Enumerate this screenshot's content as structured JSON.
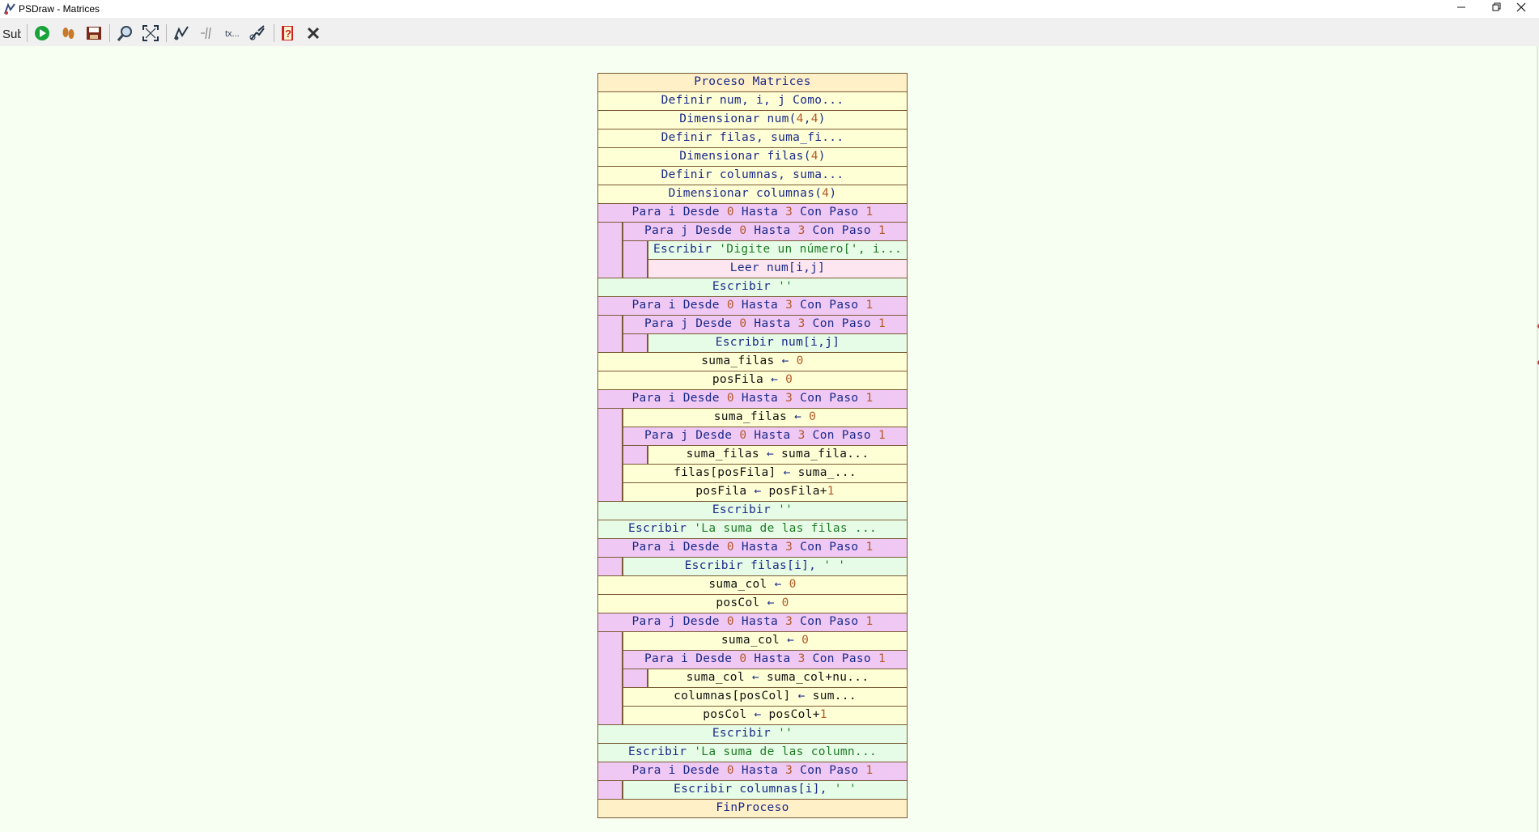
{
  "window": {
    "title": "PSDraw - Matrices",
    "controls": [
      "minimize",
      "restore",
      "close"
    ]
  },
  "toolbar": {
    "buttons": [
      {
        "name": "sub",
        "label": "Sub",
        "icon": "sub-icon"
      },
      {
        "name": "run",
        "icon": "play-icon"
      },
      {
        "name": "step",
        "icon": "footsteps-icon"
      },
      {
        "name": "save",
        "icon": "save-icon"
      },
      {
        "name": "zoom",
        "icon": "magnifier-icon"
      },
      {
        "name": "fit",
        "icon": "fit-screen-icon"
      },
      {
        "name": "edit-flow",
        "icon": "flow-edit-icon"
      },
      {
        "name": "comment",
        "icon": "comment-icon"
      },
      {
        "name": "text",
        "icon": "text-icon"
      },
      {
        "name": "tools",
        "icon": "tools-icon"
      },
      {
        "name": "help",
        "icon": "help-icon"
      },
      {
        "name": "close",
        "icon": "close-x-icon"
      }
    ]
  },
  "colors": {
    "background": "#f6fff1",
    "process": "#fff0c8",
    "assign": "#ffffd6",
    "loop": "#f0c8f4",
    "write": "#e6fce6",
    "read": "#fde6ef",
    "keyword": "#1a2a8a",
    "number": "#b35a2a",
    "string": "#207a28"
  },
  "diagram": {
    "blocks": [
      {
        "type": "proc",
        "depth": 0,
        "parts": [
          [
            "k",
            "Proceso Matrices"
          ]
        ]
      },
      {
        "type": "def",
        "depth": 0,
        "parts": [
          [
            "k",
            "Definir num, i, j Como..."
          ]
        ]
      },
      {
        "type": "def",
        "depth": 0,
        "parts": [
          [
            "k",
            "Dimensionar "
          ],
          [
            "t",
            "num("
          ],
          [
            "n",
            "4"
          ],
          [
            "t",
            ","
          ],
          [
            "n",
            "4"
          ],
          [
            "t",
            ")"
          ]
        ]
      },
      {
        "type": "def",
        "depth": 0,
        "parts": [
          [
            "k",
            "Definir filas, suma_fi..."
          ]
        ]
      },
      {
        "type": "def",
        "depth": 0,
        "parts": [
          [
            "k",
            "Dimensionar "
          ],
          [
            "t",
            "filas("
          ],
          [
            "n",
            "4"
          ],
          [
            "t",
            ")"
          ]
        ]
      },
      {
        "type": "def",
        "depth": 0,
        "parts": [
          [
            "k",
            "Definir columnas, suma..."
          ]
        ]
      },
      {
        "type": "def",
        "depth": 0,
        "parts": [
          [
            "k",
            "Dimensionar "
          ],
          [
            "t",
            "columnas("
          ],
          [
            "n",
            "4"
          ],
          [
            "t",
            ")"
          ]
        ]
      },
      {
        "type": "for",
        "depth": 0,
        "parts": [
          [
            "k",
            "Para i Desde "
          ],
          [
            "n",
            "0"
          ],
          [
            "k",
            " Hasta "
          ],
          [
            "n",
            "3"
          ],
          [
            "k",
            " Con Paso "
          ],
          [
            "n",
            "1"
          ]
        ]
      },
      {
        "type": "for",
        "depth": 1,
        "parts": [
          [
            "k",
            "Para j Desde "
          ],
          [
            "n",
            "0"
          ],
          [
            "k",
            " Hasta "
          ],
          [
            "n",
            "3"
          ],
          [
            "k",
            " Con Paso "
          ],
          [
            "n",
            "1"
          ]
        ]
      },
      {
        "type": "write",
        "depth": 2,
        "parts": [
          [
            "k",
            "Escribir "
          ],
          [
            "s",
            "'Digite un número[', i..."
          ]
        ]
      },
      {
        "type": "read",
        "depth": 2,
        "parts": [
          [
            "k",
            "Leer "
          ],
          [
            "t",
            "num[i,j]"
          ]
        ]
      },
      {
        "type": "write",
        "depth": 0,
        "parts": [
          [
            "k",
            "Escribir "
          ],
          [
            "s",
            "''"
          ]
        ]
      },
      {
        "type": "for",
        "depth": 0,
        "parts": [
          [
            "k",
            "Para i Desde "
          ],
          [
            "n",
            "0"
          ],
          [
            "k",
            " Hasta "
          ],
          [
            "n",
            "3"
          ],
          [
            "k",
            " Con Paso "
          ],
          [
            "n",
            "1"
          ]
        ]
      },
      {
        "type": "for",
        "depth": 1,
        "parts": [
          [
            "k",
            "Para j Desde "
          ],
          [
            "n",
            "0"
          ],
          [
            "k",
            " Hasta "
          ],
          [
            "n",
            "3"
          ],
          [
            "k",
            " Con Paso "
          ],
          [
            "n",
            "1"
          ]
        ]
      },
      {
        "type": "write",
        "depth": 2,
        "parts": [
          [
            "k",
            "Escribir "
          ],
          [
            "t",
            "num[i,j]"
          ]
        ]
      },
      {
        "type": "assign",
        "depth": 0,
        "parts": [
          [
            "t",
            "suma_filas "
          ],
          [
            "o",
            "←"
          ],
          [
            "t",
            " "
          ],
          [
            "n",
            "0"
          ]
        ]
      },
      {
        "type": "assign",
        "depth": 0,
        "parts": [
          [
            "t",
            "posFila "
          ],
          [
            "o",
            "←"
          ],
          [
            "t",
            " "
          ],
          [
            "n",
            "0"
          ]
        ]
      },
      {
        "type": "for",
        "depth": 0,
        "parts": [
          [
            "k",
            "Para i Desde "
          ],
          [
            "n",
            "0"
          ],
          [
            "k",
            " Hasta "
          ],
          [
            "n",
            "3"
          ],
          [
            "k",
            " Con Paso "
          ],
          [
            "n",
            "1"
          ]
        ]
      },
      {
        "type": "assign",
        "depth": 1,
        "parts": [
          [
            "t",
            "suma_filas "
          ],
          [
            "o",
            "←"
          ],
          [
            "t",
            " "
          ],
          [
            "n",
            "0"
          ]
        ]
      },
      {
        "type": "for",
        "depth": 1,
        "parts": [
          [
            "k",
            "Para j Desde "
          ],
          [
            "n",
            "0"
          ],
          [
            "k",
            " Hasta "
          ],
          [
            "n",
            "3"
          ],
          [
            "k",
            " Con Paso "
          ],
          [
            "n",
            "1"
          ]
        ]
      },
      {
        "type": "assign",
        "depth": 2,
        "parts": [
          [
            "t",
            "suma_filas "
          ],
          [
            "o",
            "←"
          ],
          [
            "t",
            " suma_fila..."
          ]
        ]
      },
      {
        "type": "assign",
        "depth": 1,
        "parts": [
          [
            "t",
            "filas[posFila] "
          ],
          [
            "o",
            "←"
          ],
          [
            "t",
            " suma_..."
          ]
        ]
      },
      {
        "type": "assign",
        "depth": 1,
        "parts": [
          [
            "t",
            "posFila "
          ],
          [
            "o",
            "←"
          ],
          [
            "t",
            " posFila+"
          ],
          [
            "n",
            "1"
          ]
        ]
      },
      {
        "type": "write",
        "depth": 0,
        "parts": [
          [
            "k",
            "Escribir "
          ],
          [
            "s",
            "''"
          ]
        ]
      },
      {
        "type": "write",
        "depth": 0,
        "parts": [
          [
            "k",
            "Escribir "
          ],
          [
            "s",
            "'La suma de las filas ..."
          ]
        ]
      },
      {
        "type": "for",
        "depth": 0,
        "parts": [
          [
            "k",
            "Para i Desde "
          ],
          [
            "n",
            "0"
          ],
          [
            "k",
            " Hasta "
          ],
          [
            "n",
            "3"
          ],
          [
            "k",
            " Con Paso "
          ],
          [
            "n",
            "1"
          ]
        ]
      },
      {
        "type": "write",
        "depth": 1,
        "parts": [
          [
            "k",
            "Escribir "
          ],
          [
            "t",
            "filas[i], "
          ],
          [
            "s",
            "' '"
          ]
        ]
      },
      {
        "type": "assign",
        "depth": 0,
        "parts": [
          [
            "t",
            "suma_col "
          ],
          [
            "o",
            "←"
          ],
          [
            "t",
            " "
          ],
          [
            "n",
            "0"
          ]
        ]
      },
      {
        "type": "assign",
        "depth": 0,
        "parts": [
          [
            "t",
            "posCol "
          ],
          [
            "o",
            "←"
          ],
          [
            "t",
            " "
          ],
          [
            "n",
            "0"
          ]
        ]
      },
      {
        "type": "for",
        "depth": 0,
        "parts": [
          [
            "k",
            "Para j Desde "
          ],
          [
            "n",
            "0"
          ],
          [
            "k",
            " Hasta "
          ],
          [
            "n",
            "3"
          ],
          [
            "k",
            " Con Paso "
          ],
          [
            "n",
            "1"
          ]
        ]
      },
      {
        "type": "assign",
        "depth": 1,
        "parts": [
          [
            "t",
            "suma_col "
          ],
          [
            "o",
            "←"
          ],
          [
            "t",
            " "
          ],
          [
            "n",
            "0"
          ]
        ]
      },
      {
        "type": "for",
        "depth": 1,
        "parts": [
          [
            "k",
            "Para i Desde "
          ],
          [
            "n",
            "0"
          ],
          [
            "k",
            " Hasta "
          ],
          [
            "n",
            "3"
          ],
          [
            "k",
            " Con Paso "
          ],
          [
            "n",
            "1"
          ]
        ]
      },
      {
        "type": "assign",
        "depth": 2,
        "parts": [
          [
            "t",
            "suma_col "
          ],
          [
            "o",
            "←"
          ],
          [
            "t",
            " suma_col+nu..."
          ]
        ]
      },
      {
        "type": "assign",
        "depth": 1,
        "parts": [
          [
            "t",
            "columnas[posCol] "
          ],
          [
            "o",
            "←"
          ],
          [
            "t",
            " sum..."
          ]
        ]
      },
      {
        "type": "assign",
        "depth": 1,
        "parts": [
          [
            "t",
            "posCol "
          ],
          [
            "o",
            "←"
          ],
          [
            "t",
            " posCol+"
          ],
          [
            "n",
            "1"
          ]
        ]
      },
      {
        "type": "write",
        "depth": 0,
        "parts": [
          [
            "k",
            "Escribir "
          ],
          [
            "s",
            "''"
          ]
        ]
      },
      {
        "type": "write",
        "depth": 0,
        "parts": [
          [
            "k",
            "Escribir "
          ],
          [
            "s",
            "'La suma de las column..."
          ]
        ]
      },
      {
        "type": "for",
        "depth": 0,
        "parts": [
          [
            "k",
            "Para i Desde "
          ],
          [
            "n",
            "0"
          ],
          [
            "k",
            " Hasta "
          ],
          [
            "n",
            "3"
          ],
          [
            "k",
            " Con Paso "
          ],
          [
            "n",
            "1"
          ]
        ]
      },
      {
        "type": "write",
        "depth": 1,
        "parts": [
          [
            "k",
            "Escribir "
          ],
          [
            "t",
            "columnas[i], "
          ],
          [
            "s",
            "' '"
          ]
        ]
      },
      {
        "type": "proc",
        "depth": 0,
        "parts": [
          [
            "k",
            "FinProceso"
          ]
        ]
      }
    ]
  }
}
